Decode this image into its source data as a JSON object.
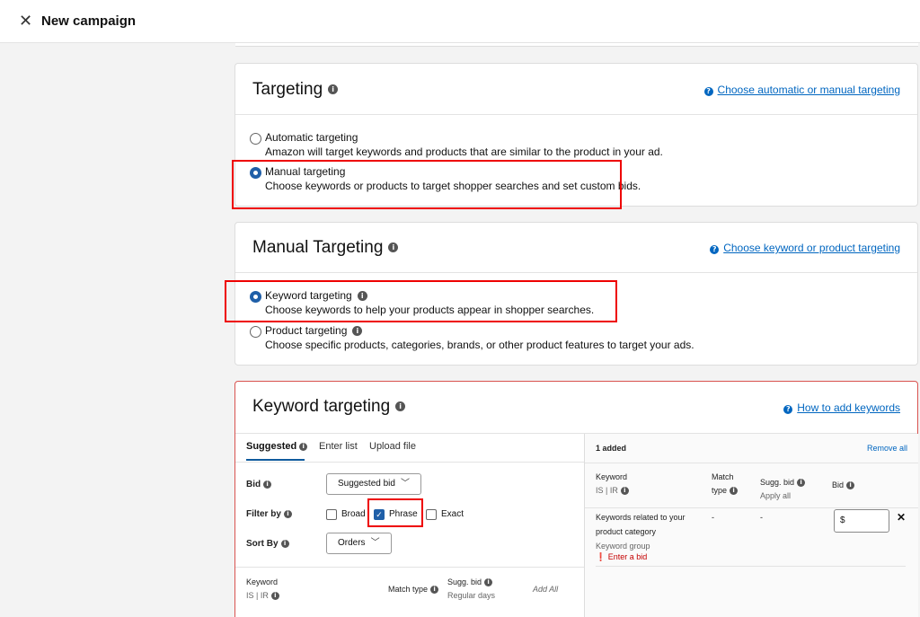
{
  "header": {
    "close_glyph": "✕",
    "title": "New campaign"
  },
  "targeting": {
    "title": "Targeting",
    "help_link": "Choose automatic or manual targeting",
    "options": [
      {
        "label": "Automatic targeting",
        "desc": "Amazon will target keywords and products that are similar to the product in your ad.",
        "selected": false
      },
      {
        "label": "Manual targeting",
        "desc": "Choose keywords or products to target shopper searches and set custom bids.",
        "selected": true
      }
    ]
  },
  "manual_targeting": {
    "title": "Manual Targeting",
    "help_link": "Choose keyword or product targeting",
    "options": [
      {
        "label": "Keyword targeting",
        "desc": "Choose keywords to help your products appear in shopper searches.",
        "selected": true
      },
      {
        "label": "Product targeting",
        "desc": "Choose specific products, categories, brands, or other product features to target your ads.",
        "selected": false
      }
    ]
  },
  "keyword_targeting": {
    "title": "Keyword targeting",
    "help_link": "How to add keywords",
    "tabs": [
      "Suggested",
      "Enter list",
      "Upload file"
    ],
    "bid_label": "Bid",
    "bid_select": "Suggested bid",
    "filter_label": "Filter by",
    "filters": [
      {
        "label": "Broad",
        "checked": false
      },
      {
        "label": "Phrase",
        "checked": true
      },
      {
        "label": "Exact",
        "checked": false
      }
    ],
    "sort_label": "Sort By",
    "sort_select": "Orders",
    "left_table": {
      "col_keyword": "Keyword",
      "col_keyword_sub": "IS | IR",
      "col_match": "Match type",
      "col_bid": "Sugg. bid",
      "col_bid_sub": "Regular days",
      "add_all": "Add All"
    },
    "right": {
      "added": "1 added",
      "remove_all": "Remove all",
      "col_keyword": "Keyword",
      "col_keyword_sub": "IS | IR",
      "col_match": "Match",
      "col_match_sub": "type",
      "col_sugg": "Sugg. bid",
      "apply_all": "Apply all",
      "col_bid": "Bid",
      "row": {
        "keyword_line1": "Keywords related to your",
        "keyword_line2": "product category",
        "group": "Keyword group",
        "error": "Enter a bid",
        "match": "-",
        "sugg": "-",
        "bid_prefix": "$",
        "remove_glyph": "✕"
      }
    }
  }
}
